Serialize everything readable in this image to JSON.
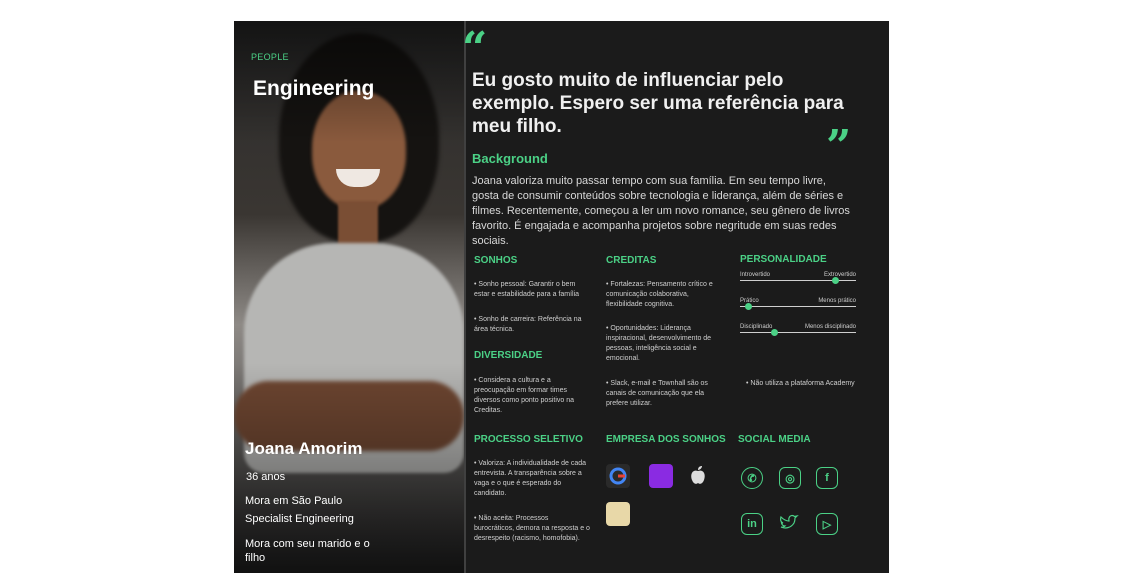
{
  "card": {
    "category": "PEOPLE",
    "area": "Engineering",
    "name": "Joana Amorim",
    "age": "36 anos",
    "city": "Mora em São Paulo",
    "role": "Specialist Engineering",
    "family": "Mora com seu marido e o filho"
  },
  "quote": {
    "open": "“",
    "text": "Eu gosto muito de influenciar pelo exemplo. Espero ser uma referência para meu filho.",
    "close": "”"
  },
  "background": {
    "title": "Background",
    "text": "Joana valoriza muito passar tempo com sua família. Em seu tempo livre, gosta de consumir conteúdos sobre tecnologia e liderança, além de séries e filmes. Recentemente, começou a ler um novo romance, seu gênero de livros favorito. É engajada e acompanha projetos sobre negritude em suas redes sociais."
  },
  "sonhos": {
    "title": "SONHOS",
    "items": [
      "• Sonho pessoal: Garantir o bem estar e estabilidade para a família",
      "• Sonho de carreira: Referência na área técnica."
    ]
  },
  "creditas": {
    "title": "CREDITAS",
    "items": [
      "• Fortalezas: Pensamento crítico e comunicação colaborativa, flexibilidade cognitiva.",
      "• Oportunidades: Liderança inspiracional, desenvolvimento de pessoas, inteligência social e emocional.",
      "• Slack, e-mail e Townhall são os canais de comunicação que ela prefere utilizar."
    ]
  },
  "personalidade": {
    "title": "PERSONALIDADE",
    "sliders": [
      {
        "left": "Introvertido",
        "right": "Extrovertido",
        "value": 0.82
      },
      {
        "left": "Prático",
        "right": "Menos prático",
        "value": 0.07
      },
      {
        "left": "Disciplinado",
        "right": "Menos disciplinado",
        "value": 0.3
      }
    ],
    "note": "• Não utiliza a plataforma Academy"
  },
  "diversidade": {
    "title": "DIVERSIDADE",
    "text": "• Considera a cultura e a preocupação em formar times diversos como ponto positivo na Creditas."
  },
  "processo": {
    "title": "PROCESSO SELETIVO",
    "items": [
      "• Valoriza: A individualidade de cada entrevista. A transparência sobre a vaga e o que é esperado do candidato.",
      "• Não aceita: Processos burocráticos, demora na resposta e o desrespeito (racismo, homofobia)."
    ]
  },
  "empresas": {
    "title": "EMPRESA DOS SONHOS",
    "logos": [
      {
        "icon": "google-logo-icon",
        "color": "#4285f4"
      },
      {
        "icon": "nubank-logo-icon",
        "color": "#8a2be2"
      },
      {
        "icon": "apple-logo-icon",
        "color": "#dddddd"
      },
      {
        "icon": "company-logo-icon",
        "color": "#e8d8a8"
      }
    ]
  },
  "social": {
    "title": "SOCIAL MEDIA",
    "icons": [
      "whatsapp-icon",
      "instagram-icon",
      "facebook-icon",
      "linkedin-icon",
      "twitter-icon",
      "youtube-icon"
    ]
  },
  "colors": {
    "accent": "#4bd186",
    "card_bg": "#1b1b1b"
  }
}
